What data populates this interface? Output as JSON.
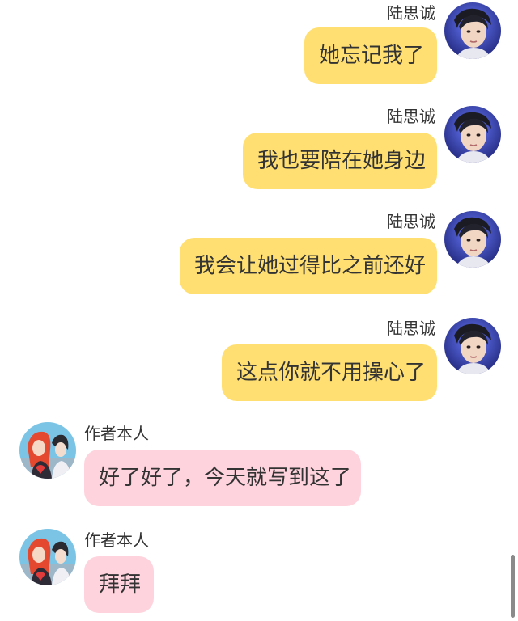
{
  "messages": [
    {
      "side": "right",
      "sender": "陆思诚",
      "text": "她忘记我了",
      "bubble_color": "#ffdf72",
      "avatar_icon": "male-avatar-icon"
    },
    {
      "side": "right",
      "sender": "陆思诚",
      "text": "我也要陪在她身边",
      "bubble_color": "#ffdf72",
      "avatar_icon": "male-avatar-icon"
    },
    {
      "side": "right",
      "sender": "陆思诚",
      "text": "我会让她过得比之前还好",
      "bubble_color": "#ffdf72",
      "avatar_icon": "male-avatar-icon"
    },
    {
      "side": "right",
      "sender": "陆思诚",
      "text": "这点你就不用操心了",
      "bubble_color": "#ffdf72",
      "avatar_icon": "male-avatar-icon"
    },
    {
      "side": "left",
      "sender": "作者本人",
      "text": "好了好了，今天就写到这了",
      "bubble_color": "#ffd3dd",
      "avatar_icon": "couple-avatar-icon"
    },
    {
      "side": "left",
      "sender": "作者本人",
      "text": "拜拜",
      "bubble_color": "#ffd3dd",
      "avatar_icon": "couple-avatar-icon"
    }
  ]
}
